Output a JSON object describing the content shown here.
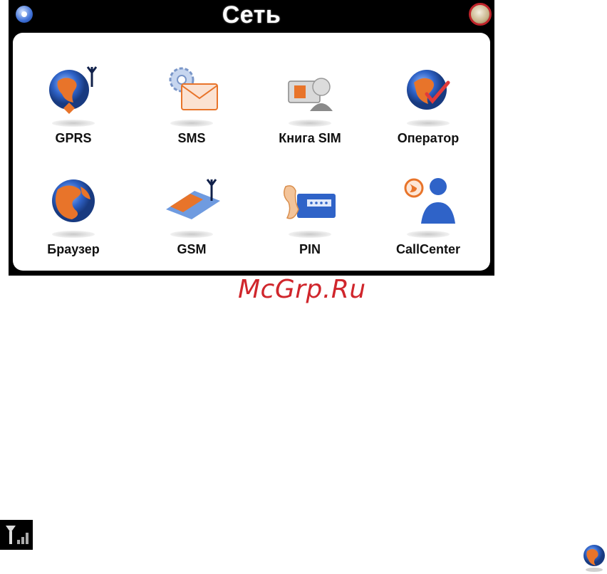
{
  "header": {
    "title": "Сеть",
    "back_icon": "back-circle-icon",
    "home_icon": "home-circle-icon"
  },
  "menu": {
    "items": [
      {
        "label": "GPRS",
        "icon": "globe-antenna-icon"
      },
      {
        "label": "SMS",
        "icon": "envelope-gear-icon"
      },
      {
        "label": "Книга SIM",
        "icon": "sim-contacts-icon"
      },
      {
        "label": "Оператор",
        "icon": "globe-check-icon"
      },
      {
        "label": "Браузер",
        "icon": "globe-browser-icon"
      },
      {
        "label": "GSM",
        "icon": "sim-card-antenna-icon"
      },
      {
        "label": "PIN",
        "icon": "pin-keypad-icon"
      },
      {
        "label": "CallCenter",
        "icon": "call-center-person-icon"
      }
    ]
  },
  "watermark": "McGrp.Ru",
  "colors": {
    "accent_orange": "#e8742a",
    "globe_blue": "#2f63c8",
    "watermark_red": "#d0262c"
  },
  "footer_icons": [
    "signal-strength-icon",
    "globe-icon"
  ]
}
